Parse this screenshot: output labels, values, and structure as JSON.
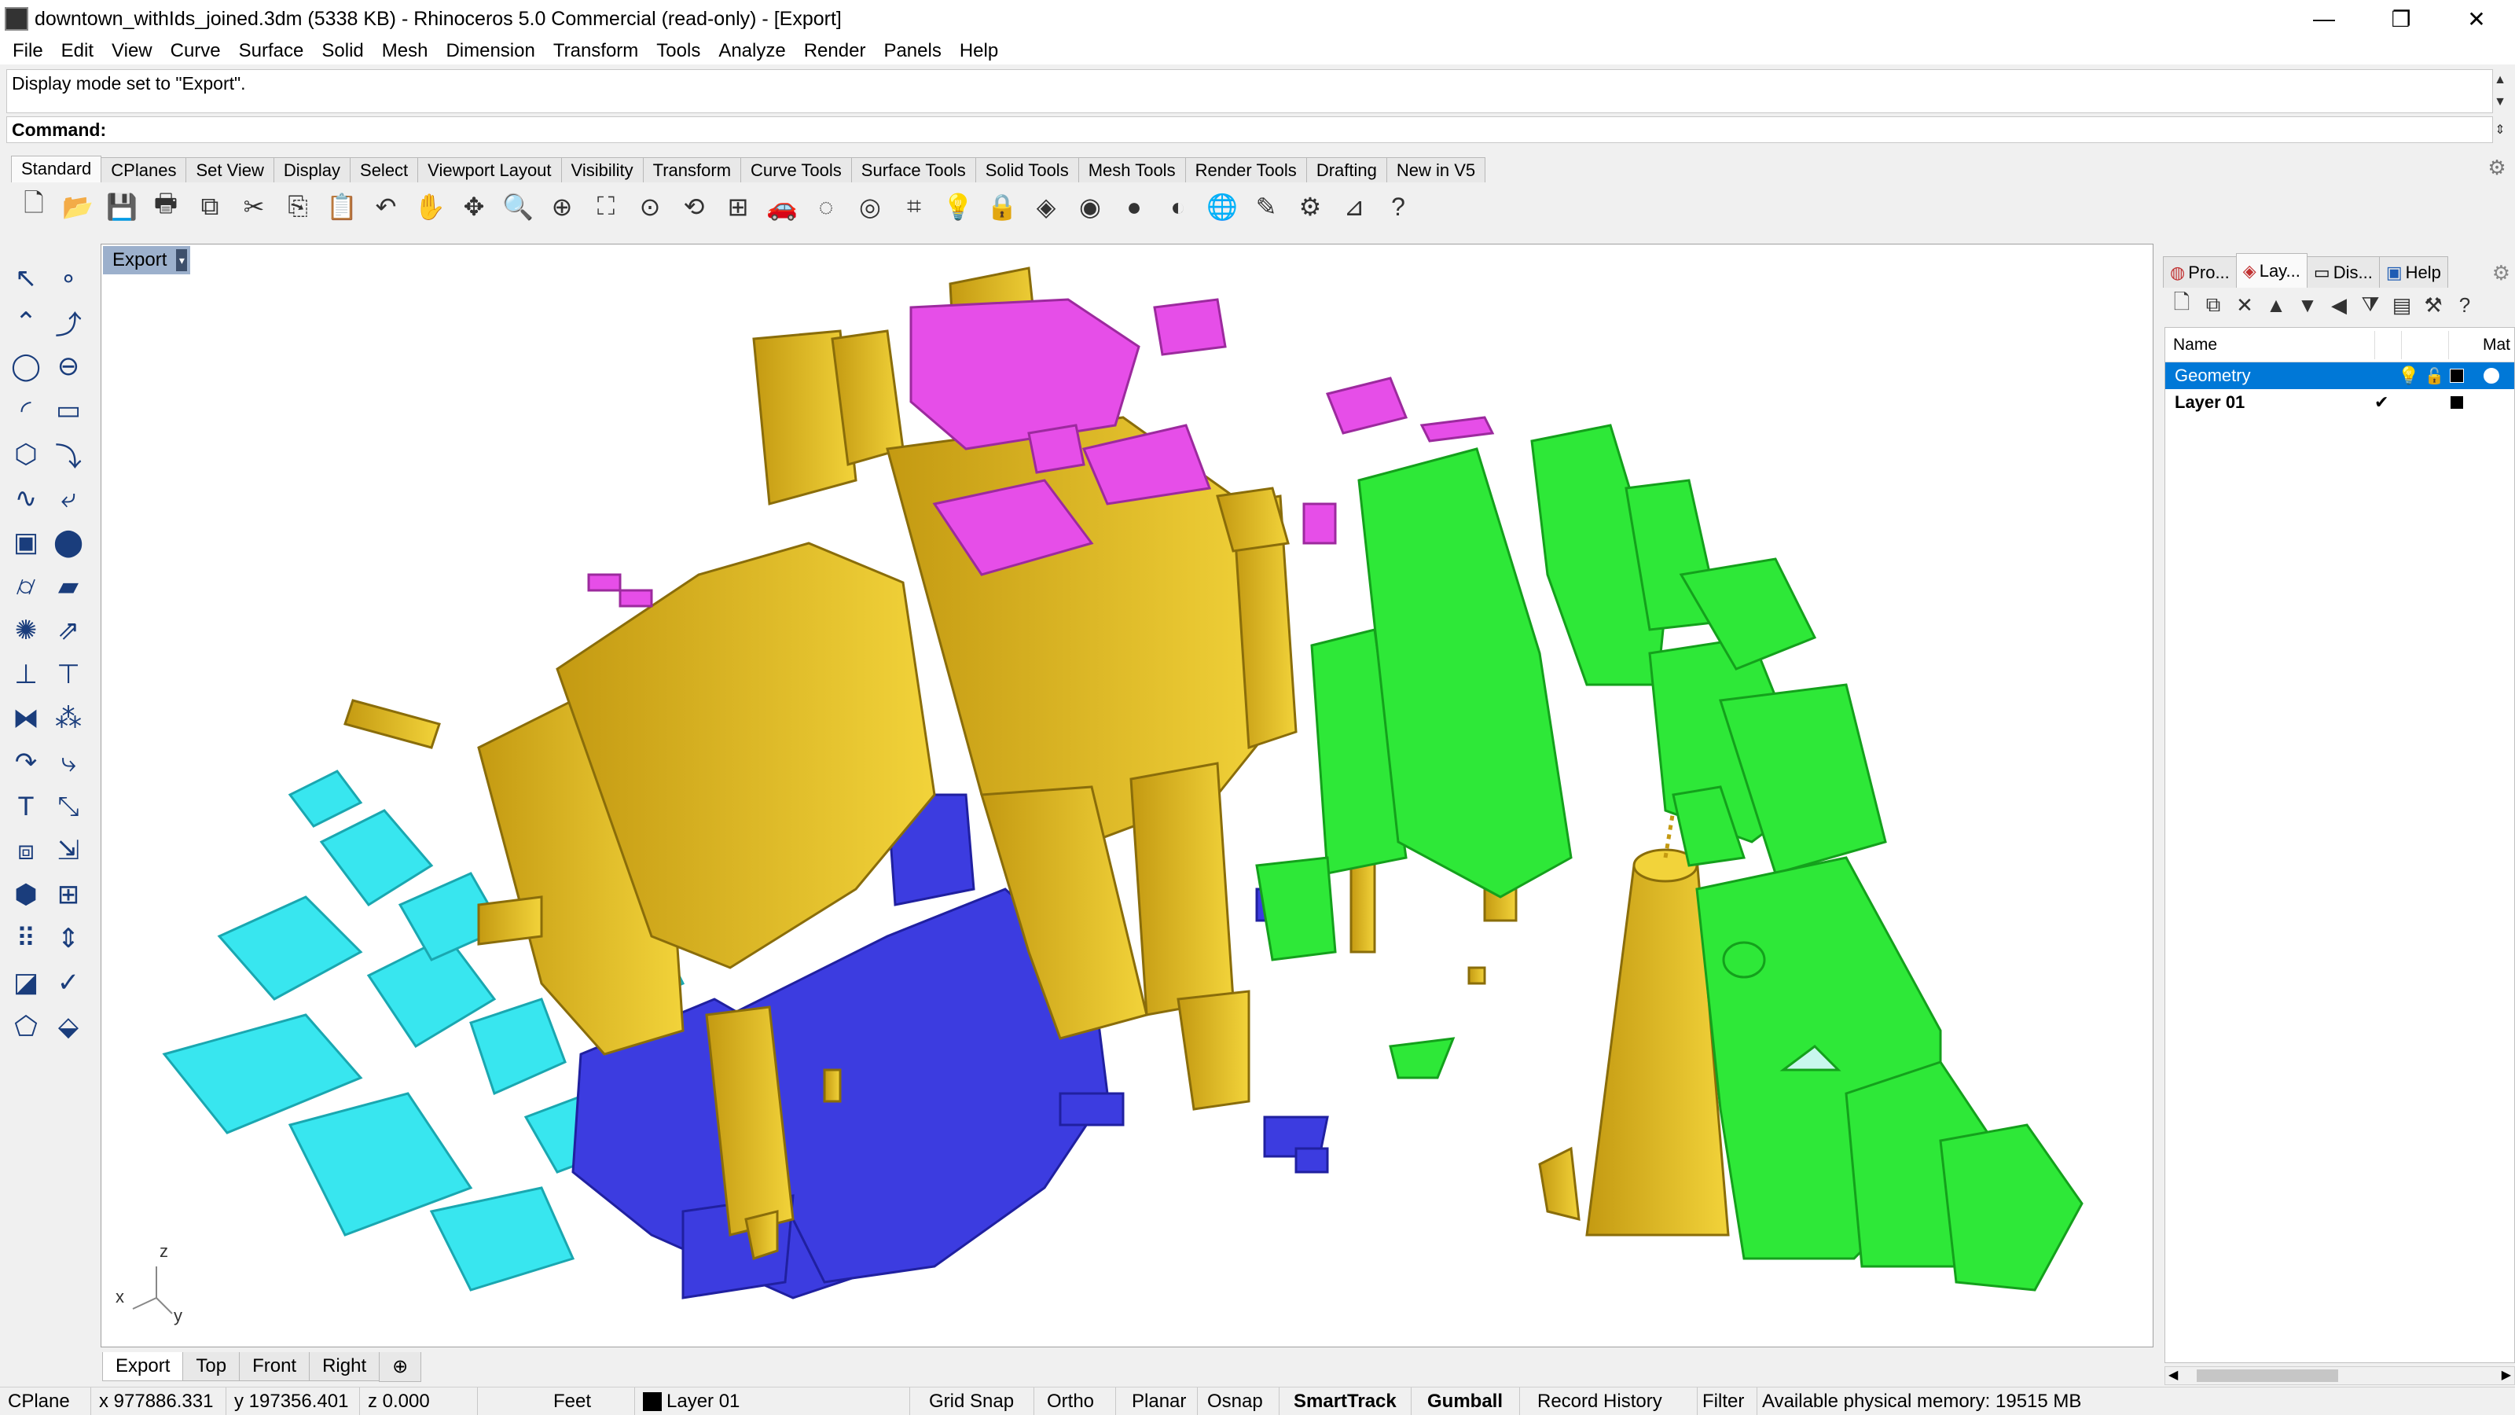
{
  "window": {
    "title": "downtown_withIds_joined.3dm (5338 KB) - Rhinoceros 5.0 Commercial (read-only) - [Export]",
    "controls": [
      "—",
      "❐",
      "✕"
    ]
  },
  "menu": [
    "File",
    "Edit",
    "View",
    "Curve",
    "Surface",
    "Solid",
    "Mesh",
    "Dimension",
    "Transform",
    "Tools",
    "Analyze",
    "Render",
    "Panels",
    "Help"
  ],
  "command": {
    "history": "Display mode set to \"Export\".",
    "prompt": "Command:"
  },
  "toolbar_tabs": [
    "Standard",
    "CPlanes",
    "Set View",
    "Display",
    "Select",
    "Viewport Layout",
    "Visibility",
    "Transform",
    "Curve Tools",
    "Surface Tools",
    "Solid Tools",
    "Mesh Tools",
    "Render Tools",
    "Drafting",
    "New in V5"
  ],
  "toolbar_icons": [
    {
      "name": "new-file-icon",
      "glyph": "🗋"
    },
    {
      "name": "open-folder-icon",
      "glyph": "📂"
    },
    {
      "name": "save-icon",
      "glyph": "💾"
    },
    {
      "name": "print-icon",
      "glyph": "🖶"
    },
    {
      "name": "attach-icon",
      "glyph": "⧉"
    },
    {
      "name": "cut-icon",
      "glyph": "✂"
    },
    {
      "name": "copy-icon",
      "glyph": "⎘"
    },
    {
      "name": "paste-icon",
      "glyph": "📋"
    },
    {
      "name": "undo-icon",
      "glyph": "↶"
    },
    {
      "name": "pan-hand-icon",
      "glyph": "✋"
    },
    {
      "name": "rotate-view-icon",
      "glyph": "✥"
    },
    {
      "name": "zoom-icon",
      "glyph": "🔍"
    },
    {
      "name": "zoom-window-icon",
      "glyph": "⊕"
    },
    {
      "name": "zoom-extents-icon",
      "glyph": "⛶"
    },
    {
      "name": "zoom-selected-icon",
      "glyph": "⊙"
    },
    {
      "name": "undo-view-icon",
      "glyph": "⟲"
    },
    {
      "name": "viewport-layout-icon",
      "glyph": "⊞"
    },
    {
      "name": "car-icon",
      "glyph": "🚗"
    },
    {
      "name": "hide-icon",
      "glyph": "◌"
    },
    {
      "name": "show-icon",
      "glyph": "◎"
    },
    {
      "name": "point-edit-icon",
      "glyph": "⌗"
    },
    {
      "name": "light-bulb-icon",
      "glyph": "💡"
    },
    {
      "name": "lock-icon",
      "glyph": "🔒"
    },
    {
      "name": "layer-icon",
      "glyph": "◈"
    },
    {
      "name": "color-wheel-icon",
      "glyph": "◉"
    },
    {
      "name": "shaded-sphere-icon",
      "glyph": "●"
    },
    {
      "name": "rendered-sphere-icon",
      "glyph": "◐"
    },
    {
      "name": "render-icon",
      "glyph": "🌐"
    },
    {
      "name": "snap-icon",
      "glyph": "✎"
    },
    {
      "name": "settings-gear-icon",
      "glyph": "⚙"
    },
    {
      "name": "dimension-icon",
      "glyph": "⊿"
    },
    {
      "name": "help-icon",
      "glyph": "?"
    }
  ],
  "left_tools": [
    {
      "name": "select-arrow-icon",
      "glyph": "↖"
    },
    {
      "name": "point-icon",
      "glyph": "∘"
    },
    {
      "name": "polyline-icon",
      "glyph": "⌃"
    },
    {
      "name": "curve-icon",
      "glyph": "⤴"
    },
    {
      "name": "circle-icon",
      "glyph": "◯"
    },
    {
      "name": "ellipse-icon",
      "glyph": "⊖"
    },
    {
      "name": "arc-icon",
      "glyph": "◜"
    },
    {
      "name": "rectangle-icon",
      "glyph": "▭"
    },
    {
      "name": "polygon-icon",
      "glyph": "⬡"
    },
    {
      "name": "fillet-icon",
      "glyph": "⤵"
    },
    {
      "name": "free-curve-icon",
      "glyph": "∿"
    },
    {
      "name": "offset-icon",
      "glyph": "⤶"
    },
    {
      "name": "box-icon",
      "glyph": "▣"
    },
    {
      "name": "sphere-icon",
      "glyph": "⬤"
    },
    {
      "name": "cylinder-icon",
      "glyph": "⌭"
    },
    {
      "name": "surface-icon",
      "glyph": "▰"
    },
    {
      "name": "explode-icon",
      "glyph": "✺"
    },
    {
      "name": "extrude-icon",
      "glyph": "⇗"
    },
    {
      "name": "join-icon",
      "glyph": "⊥"
    },
    {
      "name": "split-icon",
      "glyph": "⊤"
    },
    {
      "name": "boolean-icon",
      "glyph": "⧓"
    },
    {
      "name": "array-icon",
      "glyph": "⁂"
    },
    {
      "name": "trim-icon",
      "glyph": "↷"
    },
    {
      "name": "extend-icon",
      "glyph": "⤷"
    },
    {
      "name": "text-icon",
      "glyph": "T"
    },
    {
      "name": "scale-icon",
      "glyph": "⤡"
    },
    {
      "name": "group-icon",
      "glyph": "⧈"
    },
    {
      "name": "transform-icon",
      "glyph": "⇲"
    },
    {
      "name": "mesh-icon",
      "glyph": "⬢"
    },
    {
      "name": "dimension-tool-icon",
      "glyph": "⊞"
    },
    {
      "name": "grid-array-icon",
      "glyph": "⠿"
    },
    {
      "name": "vertical-icon",
      "glyph": "⇕"
    },
    {
      "name": "analyze-icon",
      "glyph": "◪"
    },
    {
      "name": "check-icon",
      "glyph": "✓"
    },
    {
      "name": "shell-icon",
      "glyph": "⬠"
    },
    {
      "name": "paint-icon",
      "glyph": "⬙"
    }
  ],
  "viewport": {
    "title": "Export",
    "axis": {
      "z": "z",
      "x": "x",
      "y": "y"
    },
    "tabs": [
      "Export",
      "Top",
      "Front",
      "Right",
      "⊕"
    ]
  },
  "panel": {
    "tabs": [
      "Pro...",
      "Lay...",
      "Dis...",
      "Help"
    ],
    "columns": {
      "name": "Name",
      "material": "Mat"
    },
    "layers": [
      {
        "name": "Geometry",
        "selected": true,
        "check": "",
        "color": "#000000"
      },
      {
        "name": "Layer 01",
        "selected": false,
        "check": "✔",
        "color": "#000000"
      }
    ]
  },
  "status": {
    "cplane": "CPlane",
    "x": "x 977886.331",
    "y": "y 197356.401",
    "z": "z 0.000",
    "units": "Feet",
    "layer": "Layer 01",
    "toggles": [
      "Grid Snap",
      "Ortho",
      "Planar",
      "Osnap",
      "SmartTrack",
      "Gumball",
      "Record History",
      "Filter"
    ],
    "memory": "Available physical memory: 19515 MB"
  },
  "colors": {
    "yellow": "#e8c21e",
    "magenta": "#e64ee8",
    "green": "#2ee838",
    "cyan": "#38e6ef",
    "blue": "#3c3ce0",
    "selection": "#0078d7",
    "viewport_title": "#9cb0cc"
  }
}
